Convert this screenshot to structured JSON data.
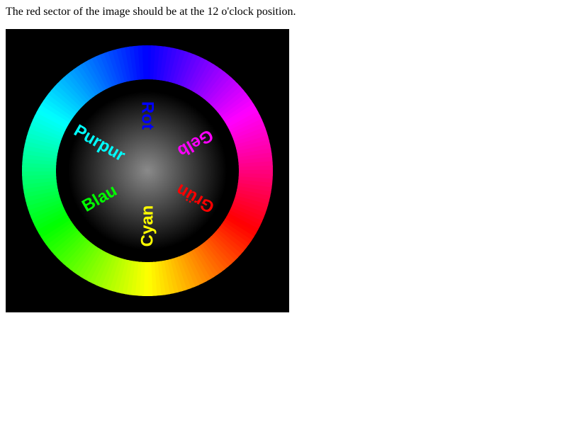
{
  "instruction_text": "The red sector of the image should be at the 12 o'clock position.",
  "color_wheel": {
    "ring_stops": [
      {
        "color": "#0000ff",
        "clock_deg": 0
      },
      {
        "color": "#ff00ff",
        "clock_deg": 60
      },
      {
        "color": "#ff0000",
        "clock_deg": 120
      },
      {
        "color": "#ffff00",
        "clock_deg": 180
      },
      {
        "color": "#00ff00",
        "clock_deg": 240
      },
      {
        "color": "#00ffff",
        "clock_deg": 300
      }
    ],
    "labels": [
      {
        "name": "rot",
        "text": "Rot",
        "color": "#0000ff",
        "clock_deg": 0
      },
      {
        "name": "gelb",
        "text": "Gelb",
        "color": "#ff00ff",
        "clock_deg": 60
      },
      {
        "name": "gruen",
        "text": "Grün",
        "color": "#ff0000",
        "clock_deg": 120
      },
      {
        "name": "cyan",
        "text": "Cyan",
        "color": "#ffff00",
        "clock_deg": 180
      },
      {
        "name": "blau",
        "text": "Blau",
        "color": "#00ff00",
        "clock_deg": 240
      },
      {
        "name": "purpur",
        "text": "Purpur",
        "color": "#00ffff",
        "clock_deg": 300
      }
    ],
    "background_color": "#000000",
    "center_glow_color": "#8a8a8a"
  }
}
